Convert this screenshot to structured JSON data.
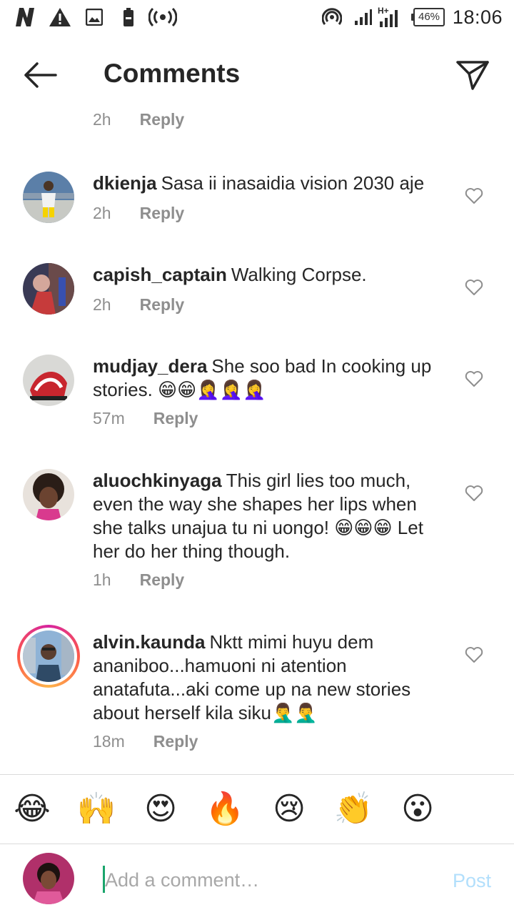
{
  "status_bar": {
    "icons": [
      "netflix-icon",
      "warning-icon",
      "gallery-icon",
      "battery-saver-icon",
      "radio-icon",
      "hotspot-icon",
      "signal-icon",
      "signal-hplus-icon"
    ],
    "network": "H+",
    "battery": "46%",
    "time": "18:06"
  },
  "header": {
    "title": "Comments"
  },
  "first_meta": {
    "time": "2h",
    "reply": "Reply"
  },
  "comments": [
    {
      "user": "dkienja",
      "text": "Sasa ii inasaidia vision 2030 aje",
      "time": "2h",
      "reply": "Reply"
    },
    {
      "user": "capish_captain",
      "text": "Walking Corpse.",
      "time": "2h",
      "reply": "Reply"
    },
    {
      "user": "mudjay_dera",
      "text": "She soo bad In cooking up stories. 😁😁🤦‍♀️🤦‍♀️🤦‍♀️",
      "time": "57m",
      "reply": "Reply"
    },
    {
      "user": "aluochkinyaga",
      "text": "This girl lies too much, even the way she shapes her lips when she talks unajua tu ni uongo! 😁😁😁 Let her do her thing though.",
      "time": "1h",
      "reply": "Reply"
    },
    {
      "user": "alvin.kaunda",
      "text": "Nktt mimi huyu dem ananiboo...hamuoni ni atention anatafuta...aki come up na new stories about herself kila siku🤦‍♂️🤦‍♂️",
      "time": "18m",
      "reply": "Reply"
    }
  ],
  "emoji_bar": [
    "😂",
    "🙌",
    "😍",
    "🔥",
    "😢",
    "👏",
    "😮"
  ],
  "composer": {
    "placeholder": "Add a comment…",
    "post_label": "Post"
  },
  "colors": {
    "meta_gray": "#8e8e8e",
    "post_disabled": "#b2dffc",
    "cursor": "#1aa56c"
  }
}
